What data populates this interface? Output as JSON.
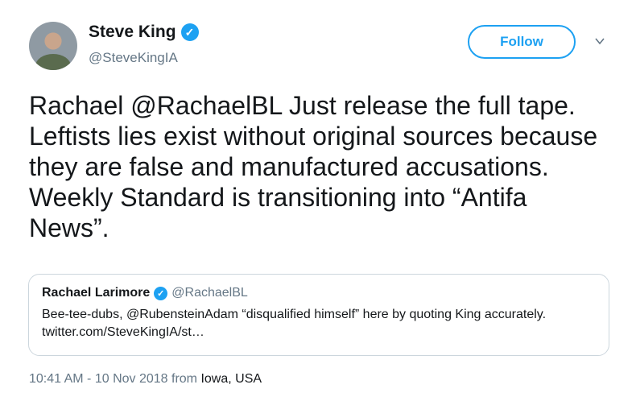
{
  "tweet": {
    "author": {
      "name": "Steve King",
      "handle": "@SteveKingIA",
      "verified_icon": "check-badge-icon"
    },
    "follow_label": "Follow",
    "text": "Rachael @RachaelBL Just release the full tape. Leftists lies exist without original sources because they are false and manufactured accusations. Weekly Standard is transitioning into “Antifa News”.",
    "quoted": {
      "name": "Rachael Larimore",
      "handle": "@RachaelBL",
      "text": "Bee-tee-dubs, @RubensteinAdam “disqualified himself” here by quoting King accurately. twitter.com/SteveKingIA/st…"
    },
    "timestamp": "10:41 AM - 10 Nov 2018 from",
    "location": "Iowa, USA"
  },
  "colors": {
    "accent": "#1da1f2",
    "secondary_text": "#657786",
    "border": "#ccd6dd"
  }
}
